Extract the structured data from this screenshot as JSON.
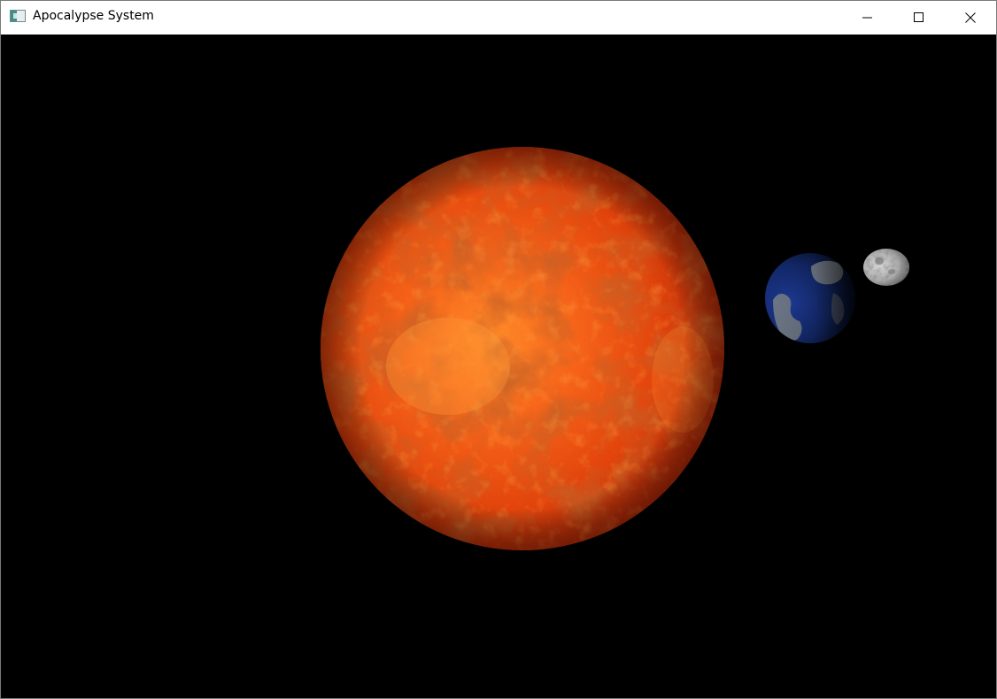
{
  "window": {
    "title": "Apocalypse System",
    "icon": "app-window-icon"
  },
  "controls": {
    "minimize_icon": "minimize-icon",
    "maximize_icon": "maximize-icon",
    "close_icon": "close-icon"
  },
  "scene": {
    "background_color": "#000000",
    "bodies": [
      {
        "name": "sun",
        "color": "#e8410a"
      },
      {
        "name": "earth",
        "color": "#1c2f6e"
      },
      {
        "name": "moon",
        "color": "#9a9a9a"
      }
    ]
  }
}
